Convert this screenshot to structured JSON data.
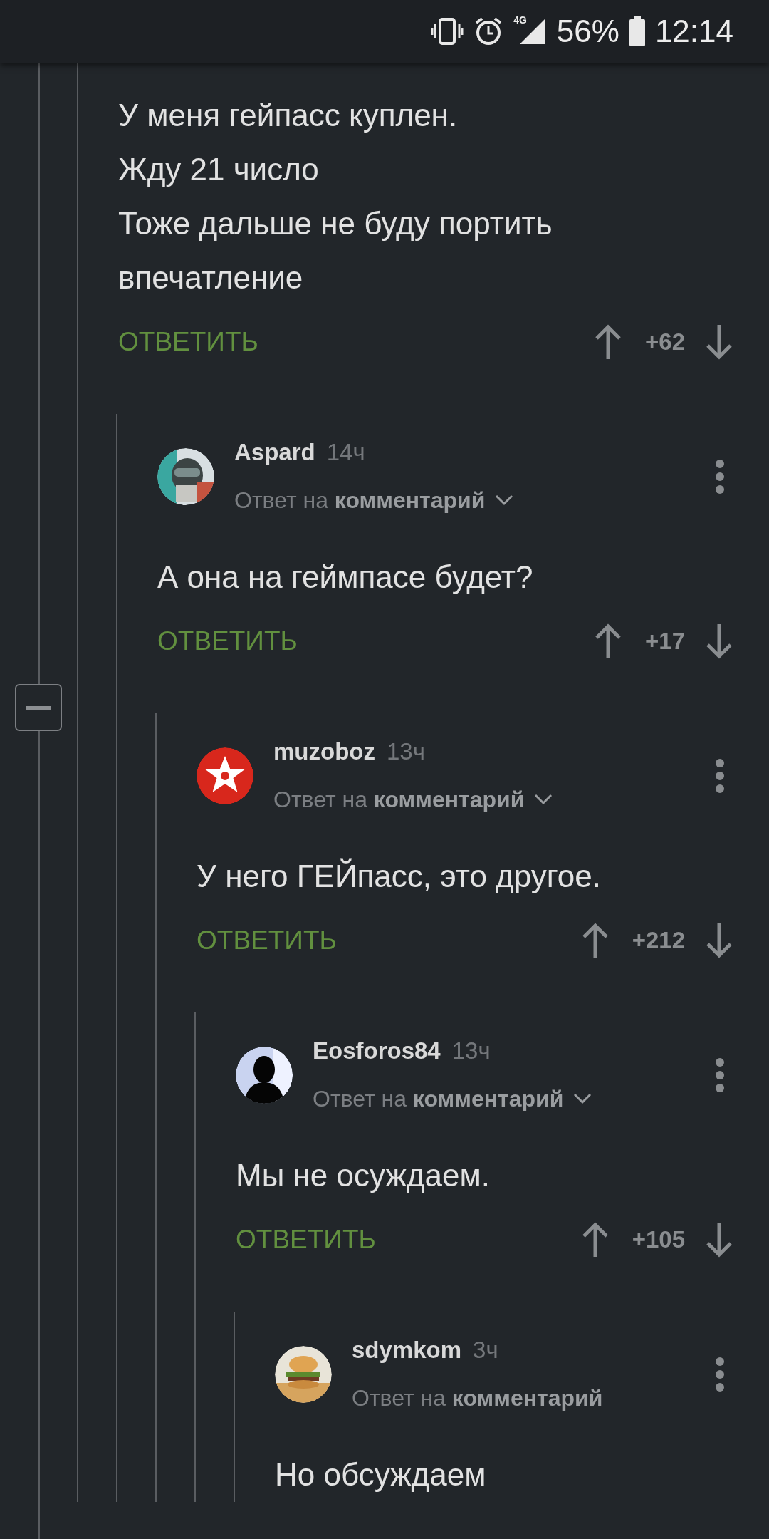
{
  "status_bar": {
    "network": "4G",
    "battery": "56%",
    "time": "12:14"
  },
  "comments": [
    {
      "text": "У меня гейпасс куплен.\nЖду 21 число\nТоже дальше не буду портить впечатление",
      "reply_label": "ОТВЕТИТЬ",
      "score": "+62",
      "children": [
        {
          "author": "Aspard",
          "time": "14ч",
          "reply_to": "Ответ на **комментарий**",
          "expandable": true,
          "text": "А она на геймпасе будет?",
          "reply_label": "ОТВЕТИТЬ",
          "score": "+17",
          "children": [
            {
              "author": "muzoboz",
              "time": "13ч",
              "reply_to": "Ответ на **комментарий**",
              "expandable": true,
              "text": "У него ГЕЙпасс, это другое.",
              "reply_label": "ОТВЕТИТЬ",
              "score": "+212",
              "children": [
                {
                  "author": "Eosforos84",
                  "time": "13ч",
                  "reply_to": "Ответ на **комментарий**",
                  "expandable": true,
                  "text": "Мы не осуждаем.",
                  "reply_label": "ОТВЕТИТЬ",
                  "score": "+105",
                  "children": [
                    {
                      "author": "sdymkom",
                      "time": "3ч",
                      "reply_to": "Ответ на **комментарий**",
                      "expandable": false,
                      "text": "Но обсуждаем"
                    }
                  ]
                }
              ]
            }
          ]
        }
      ]
    }
  ]
}
